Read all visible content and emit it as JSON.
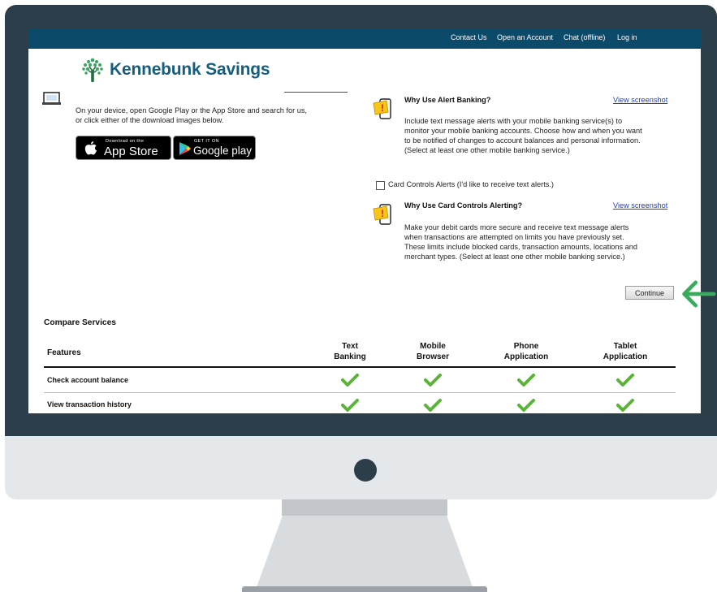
{
  "nav": {
    "links": [
      "Contact Us",
      "Open an Account",
      "Chat (offline)",
      "Log in"
    ]
  },
  "logo": {
    "text": "Kennebunk Savings",
    "icon": "tree-icon"
  },
  "left": {
    "intro_line1": "On your device, open Google Play or the App Store and search for us,",
    "intro_line2": "or click either of the download images below.",
    "app_store": {
      "small": "Download on the",
      "big": "App Store"
    },
    "google_play": {
      "small": "GET IT ON",
      "big": "Google play"
    }
  },
  "alert": {
    "heading": "Why Use Alert Banking?",
    "link": "View screenshot",
    "lines": [
      "Include text message alerts with your mobile banking service(s) to",
      "monitor your mobile banking accounts. Choose how and when you want",
      "to be notified of changes to account balances and personal information.",
      "(Select at least one other mobile banking service.)"
    ]
  },
  "card_controls": {
    "checkbox_label": "Card Controls Alerts (I'd like to receive text alerts.)",
    "checked": false,
    "heading": "Why Use Card Controls Alerting?",
    "link": "View screenshot",
    "lines": [
      "Make your debit cards more secure and receive text message alerts",
      "when transactions are attempted on limits you have previously set.",
      "These limits include blocked cards, transaction amounts, locations and",
      "merchant types. (Select at least one other mobile banking service.)"
    ]
  },
  "continue_label": "Continue",
  "compare": {
    "title": "Compare Services",
    "headers": {
      "features": "Features",
      "col1a": "Text",
      "col1b": "Banking",
      "col2a": "Mobile",
      "col2b": "Browser",
      "col3a": "Phone",
      "col3b": "Application",
      "col4a": "Tablet",
      "col4b": "Application"
    },
    "rows": [
      {
        "label": "Check account balance",
        "checks": [
          true,
          true,
          true,
          true
        ]
      },
      {
        "label": "View transaction history",
        "checks": [
          true,
          true,
          true,
          true
        ]
      }
    ]
  },
  "colors": {
    "nav": "#0c4a6a",
    "logo": "#155e7e",
    "link": "#1a3fbf",
    "check": "#5bb33a",
    "arrow": "#3aaa5c",
    "bezel": "#2d3e4b"
  }
}
